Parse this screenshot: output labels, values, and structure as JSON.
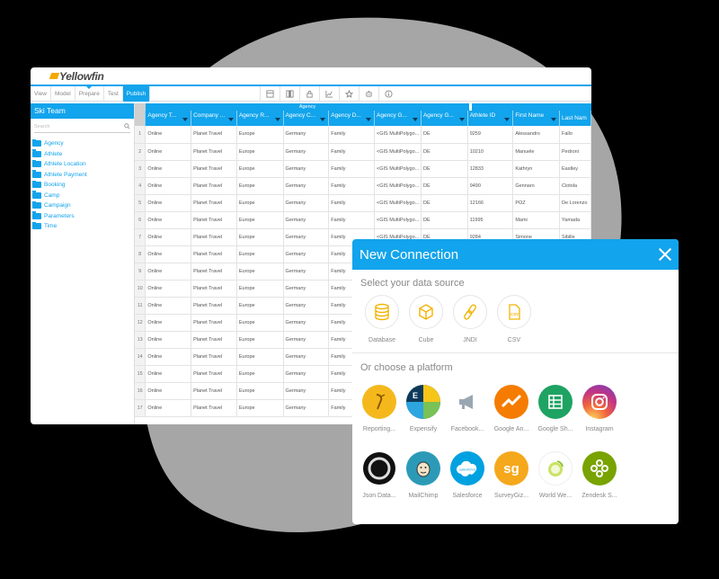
{
  "brand": {
    "logo_text": "Yellowfin"
  },
  "menu": [
    "View",
    "Model",
    "Prepare",
    "Test",
    "Publish"
  ],
  "toolbar_icons": [
    "table-icon",
    "column-icon",
    "lock-icon",
    "chart-icon",
    "star-icon",
    "robot-icon",
    "info-icon"
  ],
  "sidebar": {
    "title": "Ski Team",
    "search_placeholder": "Search",
    "items": [
      "Agency",
      "Athlete",
      "Athlete Location",
      "Athlete Payment",
      "Booking",
      "Camp",
      "Campaign",
      "Parameters",
      "Time"
    ]
  },
  "grid": {
    "group_label": "Agency",
    "columns": [
      "Agency T...",
      "Company ...",
      "Agency R...",
      "Agency C...",
      "Agency D...",
      "Agency G...",
      "Agency G...",
      "Athlete ID",
      "First Name",
      "Last Nam"
    ],
    "rows": [
      [
        "1",
        "Online",
        "Planet Travel",
        "Europe",
        "Germany",
        "Family",
        "<GIS MultiPolygo...",
        "DE",
        "9259",
        "Alessandro",
        "Fallo"
      ],
      [
        "2",
        "Online",
        "Planet Travel",
        "Europe",
        "Germany",
        "Family",
        "<GIS MultiPolygo...",
        "DE",
        "10210",
        "Manuele",
        "Pedroni"
      ],
      [
        "3",
        "Online",
        "Planet Travel",
        "Europe",
        "Germany",
        "Family",
        "<GIS MultiPolygo...",
        "DE",
        "12833",
        "Kathryn",
        "Eastley"
      ],
      [
        "4",
        "Online",
        "Planet Travel",
        "Europe",
        "Germany",
        "Family",
        "<GIS MultiPolygo...",
        "DE",
        "9490",
        "Gennaro",
        "Ciotola"
      ],
      [
        "5",
        "Online",
        "Planet Travel",
        "Europe",
        "Germany",
        "Family",
        "<GIS MultiPolygo...",
        "DE",
        "12166",
        "POZ",
        "De Lorenzo"
      ],
      [
        "6",
        "Online",
        "Planet Travel",
        "Europe",
        "Germany",
        "Family",
        "<GIS MultiPolygo...",
        "DE",
        "11995",
        "Mami",
        "Yamada"
      ],
      [
        "7",
        "Online",
        "Planet Travel",
        "Europe",
        "Germany",
        "Family",
        "<GIS MultiPolygo...",
        "DE",
        "9284",
        "Simone",
        "Sibille"
      ],
      [
        "8",
        "Online",
        "Planet Travel",
        "Europe",
        "Germany",
        "Family",
        "",
        "",
        "",
        "",
        ""
      ],
      [
        "9",
        "Online",
        "Planet Travel",
        "Europe",
        "Germany",
        "Family",
        "",
        "",
        "",
        "",
        ""
      ],
      [
        "10",
        "Online",
        "Planet Travel",
        "Europe",
        "Germany",
        "Family",
        "",
        "",
        "",
        "",
        ""
      ],
      [
        "11",
        "Online",
        "Planet Travel",
        "Europe",
        "Germany",
        "Family",
        "",
        "",
        "",
        "",
        ""
      ],
      [
        "12",
        "Online",
        "Planet Travel",
        "Europe",
        "Germany",
        "Family",
        "",
        "",
        "",
        "",
        ""
      ],
      [
        "13",
        "Online",
        "Planet Travel",
        "Europe",
        "Germany",
        "Family",
        "",
        "",
        "",
        "",
        ""
      ],
      [
        "14",
        "Online",
        "Planet Travel",
        "Europe",
        "Germany",
        "Family",
        "",
        "",
        "",
        "",
        ""
      ],
      [
        "15",
        "Online",
        "Planet Travel",
        "Europe",
        "Germany",
        "Family",
        "",
        "",
        "",
        "",
        ""
      ],
      [
        "16",
        "Online",
        "Planet Travel",
        "Europe",
        "Germany",
        "Family",
        "",
        "",
        "",
        "",
        ""
      ],
      [
        "17",
        "Online",
        "Planet Travel",
        "Europe",
        "Germany",
        "Family",
        "",
        "",
        "",
        "",
        ""
      ]
    ]
  },
  "modal": {
    "title": "New Connection",
    "source_heading": "Select your data source",
    "sources": [
      {
        "label": "Database",
        "icon": "database-icon"
      },
      {
        "label": "Cube",
        "icon": "cube-icon"
      },
      {
        "label": "JNDI",
        "icon": "link-icon"
      },
      {
        "label": "CSV",
        "icon": "csv-file-icon"
      }
    ],
    "platform_heading": "Or choose a platform",
    "platforms_row1": [
      {
        "label": "Reporting...",
        "icon": "reporting-icon",
        "color": "#f5b81c"
      },
      {
        "label": "Expensify",
        "icon": "expensify-icon",
        "color": "#0d3a5a"
      },
      {
        "label": "Facebook...",
        "icon": "megaphone-icon",
        "color": "#ffffff"
      },
      {
        "label": "Google An...",
        "icon": "google-analytics-icon",
        "color": "#f57c00"
      },
      {
        "label": "Google Sh...",
        "icon": "google-sheets-icon",
        "color": "#1ea362"
      },
      {
        "label": "Instagram",
        "icon": "instagram-icon",
        "color": "#c13584"
      }
    ],
    "platforms_row2": [
      {
        "label": "Json Data...",
        "icon": "json-icon",
        "color": "#111111"
      },
      {
        "label": "MailChimp",
        "icon": "mailchimp-icon",
        "color": "#2c9ab7"
      },
      {
        "label": "Salesforce",
        "icon": "salesforce-icon",
        "color": "#00a1e0"
      },
      {
        "label": "SurveyGiz...",
        "icon": "surveygizmo-icon",
        "color": "#f5a81c"
      },
      {
        "label": "World We...",
        "icon": "world-weather-icon",
        "color": "#ffffff"
      },
      {
        "label": "Zendesk S...",
        "icon": "zendesk-icon",
        "color": "#78a300"
      }
    ]
  },
  "colors": {
    "accent": "#12a4ec",
    "background": "#000000",
    "blob": "#9a9a9a"
  }
}
